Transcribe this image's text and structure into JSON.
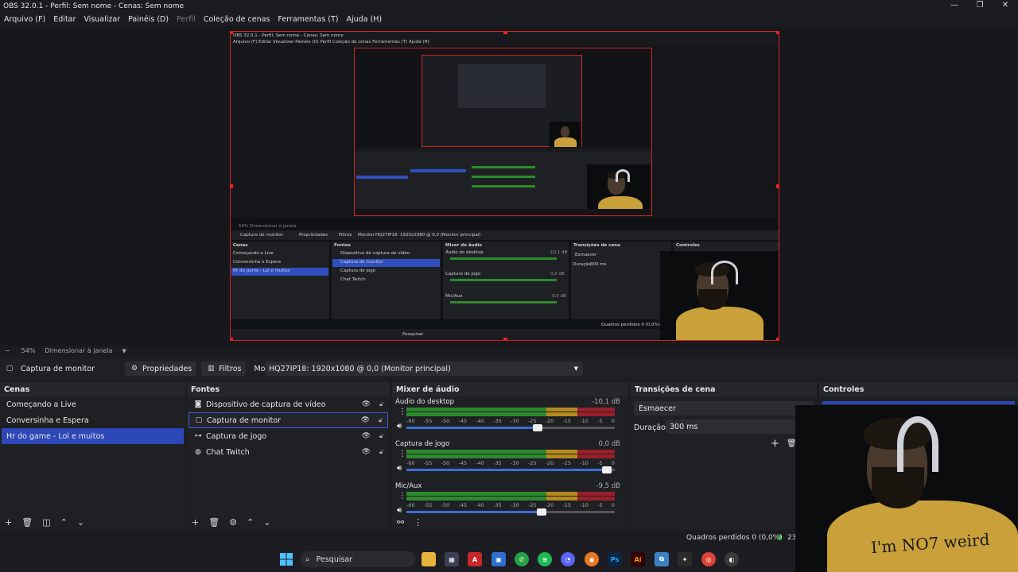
{
  "window": {
    "title": "OBS 32.0.1 - Perfil: Sem nome - Cenas: Sem nome",
    "minimize": "—",
    "maximize": "❐",
    "close": "✕"
  },
  "menu": [
    {
      "label": "Arquivo (F)",
      "enabled": true
    },
    {
      "label": "Editar",
      "enabled": true
    },
    {
      "label": "Visualizar",
      "enabled": true
    },
    {
      "label": "Painéis (D)",
      "enabled": true
    },
    {
      "label": "Perfil",
      "enabled": false
    },
    {
      "label": "Coleção de cenas",
      "enabled": true
    },
    {
      "label": "Ferramentas (T)",
      "enabled": true
    },
    {
      "label": "Ajuda (H)",
      "enabled": true
    }
  ],
  "zoom": {
    "minus": "−",
    "value": "54%",
    "mode": "Dimensionar à janela"
  },
  "source_toolbar": {
    "source_name": "Captura de monitor",
    "properties_label": "Propriedades",
    "filters_label": "Filtros",
    "monitor_label": "Monitor",
    "monitor_value": "HQ27IP18: 1920x1080 @ 0,0 (Monitor principal)"
  },
  "scenes": {
    "title": "Cenas",
    "items": [
      {
        "label": "Começando a Live",
        "selected": false
      },
      {
        "label": "Conversinha e Espera",
        "selected": false
      },
      {
        "label": "Hr do game - Lol e muitos",
        "selected": true
      }
    ]
  },
  "sources": {
    "title": "Fontes",
    "items": [
      {
        "label": "Dispositivo de captura de vídeo",
        "icon": "camera-icon",
        "selected": false
      },
      {
        "label": "Captura de monitor",
        "icon": "monitor-icon",
        "selected": true
      },
      {
        "label": "Captura de jogo",
        "icon": "gamepad-icon",
        "selected": false
      },
      {
        "label": "Chat Twitch",
        "icon": "globe-icon",
        "selected": false
      }
    ]
  },
  "mixer": {
    "title": "Mixer de áudio",
    "ticks": [
      "-60",
      "-55",
      "-50",
      "-45",
      "-40",
      "-35",
      "-30",
      "-25",
      "-20",
      "-15",
      "-10",
      "-5",
      "0"
    ],
    "channels": [
      {
        "name": "Áudio do desktop",
        "db": "-10,1 dB",
        "volume": 0.63
      },
      {
        "name": "Captura de jogo",
        "db": "0,0 dB",
        "volume": 0.96
      },
      {
        "name": "Mic/Aux",
        "db": "-9,5 dB",
        "volume": 0.65
      }
    ]
  },
  "transitions": {
    "title": "Transições de cena",
    "selected": "Esmaecer",
    "duration_label": "Duração",
    "duration_value": "300 ms"
  },
  "controls": {
    "title": "Controles"
  },
  "status": {
    "dropped_frames": "Quadros perdidos 0 (0,0%)",
    "extra": "23"
  },
  "taskbar": {
    "search_placeholder": "Pesquisar"
  },
  "preview_nested": {
    "title": "OBS 32.0.1 - Perfil: Sem nome - Cenas: Sem nome",
    "menu": "Arquivo (F)  Editar  Visualizar  Painéis (D)  Perfil  Coleção de cenas  Ferramentas (T)  Ajuda (H)",
    "zoom": "54%   Dimensionar à janela",
    "source": "Captura de monitor",
    "properties": "Propriedades",
    "filters": "Filtros",
    "monitor": "Monitor",
    "monitor_value": "HQ27IP18: 1920x1080 @ 0,0 (Monitor principal)",
    "scenes_title": "Cenas",
    "scene1": "Começando a Live",
    "scene2": "Conversinha e Espera",
    "scene3": "Hr do game - Lol e muitos",
    "sources_title": "Fontes",
    "src1": "Dispositivo de captura de vídeo",
    "src2": "Captura de monitor",
    "src3": "Captura de jogo",
    "src4": "Chat Twitch",
    "mixer_title": "Mixer de áudio",
    "ch1": "Áudio do desktop",
    "ch1_db": "-10,1 dB",
    "ch2": "Captura de jogo",
    "ch2_db": "0,0 dB",
    "ch3": "Mic/Aux",
    "ch3_db": "-9,5 dB",
    "transitions_title": "Transições de cena",
    "transition": "Esmaecer",
    "duration_label": "Duração",
    "duration_value": "300 ms",
    "controls_title": "Controles",
    "dropped": "Quadros perdidos 0 (0,0%)",
    "search": "Pesquisar"
  },
  "webcam": {
    "shirt_text": "I'm NO7 weird"
  }
}
